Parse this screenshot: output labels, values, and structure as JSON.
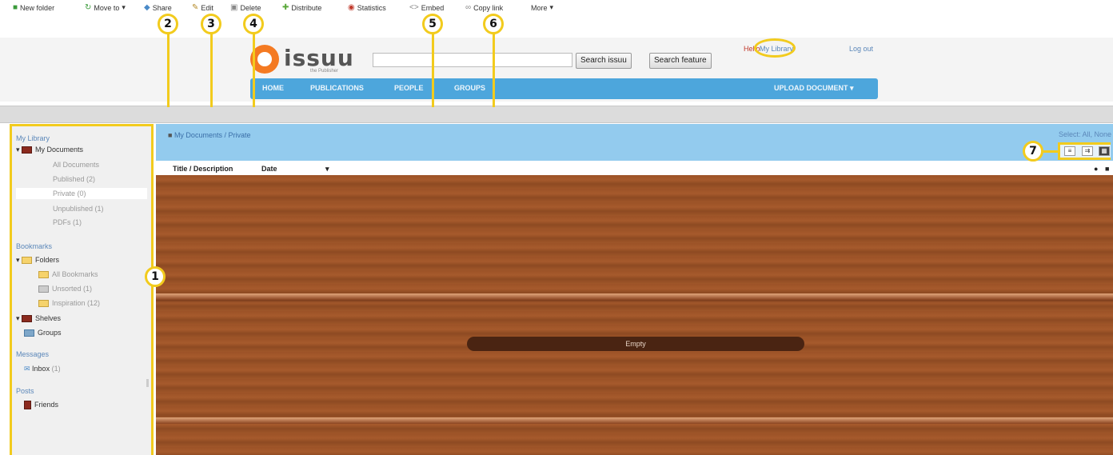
{
  "markers": [
    "1",
    "2",
    "3",
    "4",
    "5",
    "6",
    "7"
  ],
  "header": {
    "logo_text": "issuu",
    "logo_tagline": "the Publisher",
    "search_placeholder": "",
    "search_issuu_label": "Search issuu",
    "search_feature_label": "Search feature",
    "user_prefix": "Hello",
    "my_library_link": "My Library",
    "logout_link": "Log out"
  },
  "nav": {
    "items": [
      "HOME",
      "PUBLICATIONS",
      "PEOPLE",
      "GROUPS"
    ],
    "upload_label": "UPLOAD DOCUMENT"
  },
  "toolbar": {
    "items": [
      "New folder",
      "Move to",
      "Share",
      "Edit",
      "Delete",
      "Distribute",
      "Statistics",
      "Embed",
      "Copy link",
      "More"
    ]
  },
  "sidebar": {
    "my_library_heading": "My Library",
    "my_documents": "My Documents",
    "doc_subitems": [
      "All Documents",
      "Published (2)",
      "Private (0)",
      "Unpublished (1)",
      "PDFs (1)"
    ],
    "bookmarks_heading": "Bookmarks",
    "folders": "Folders",
    "folder_items": [
      "All Bookmarks",
      "Unsorted (1)",
      "Inspiration (12)"
    ],
    "shelves": "Shelves",
    "groups": "Groups",
    "messages_heading": "Messages",
    "inbox": "Inbox",
    "inbox_count": "(1)",
    "posts_heading": "Posts",
    "posts_item": "Friends"
  },
  "content": {
    "breadcrumb": "My Documents / Private",
    "select_all_label": "Select: All, None",
    "col_title": "Title / Description",
    "col_date": "Date",
    "empty_label": "Empty",
    "view_modes": [
      "list-view-icon",
      "detail-view-icon",
      "grid-view-icon"
    ]
  },
  "colors": {
    "highlight": "#f2cb1d",
    "nav_blue": "#4da6dc",
    "brand_orange": "#f47a22",
    "shelf_wood": "#9a5128"
  }
}
